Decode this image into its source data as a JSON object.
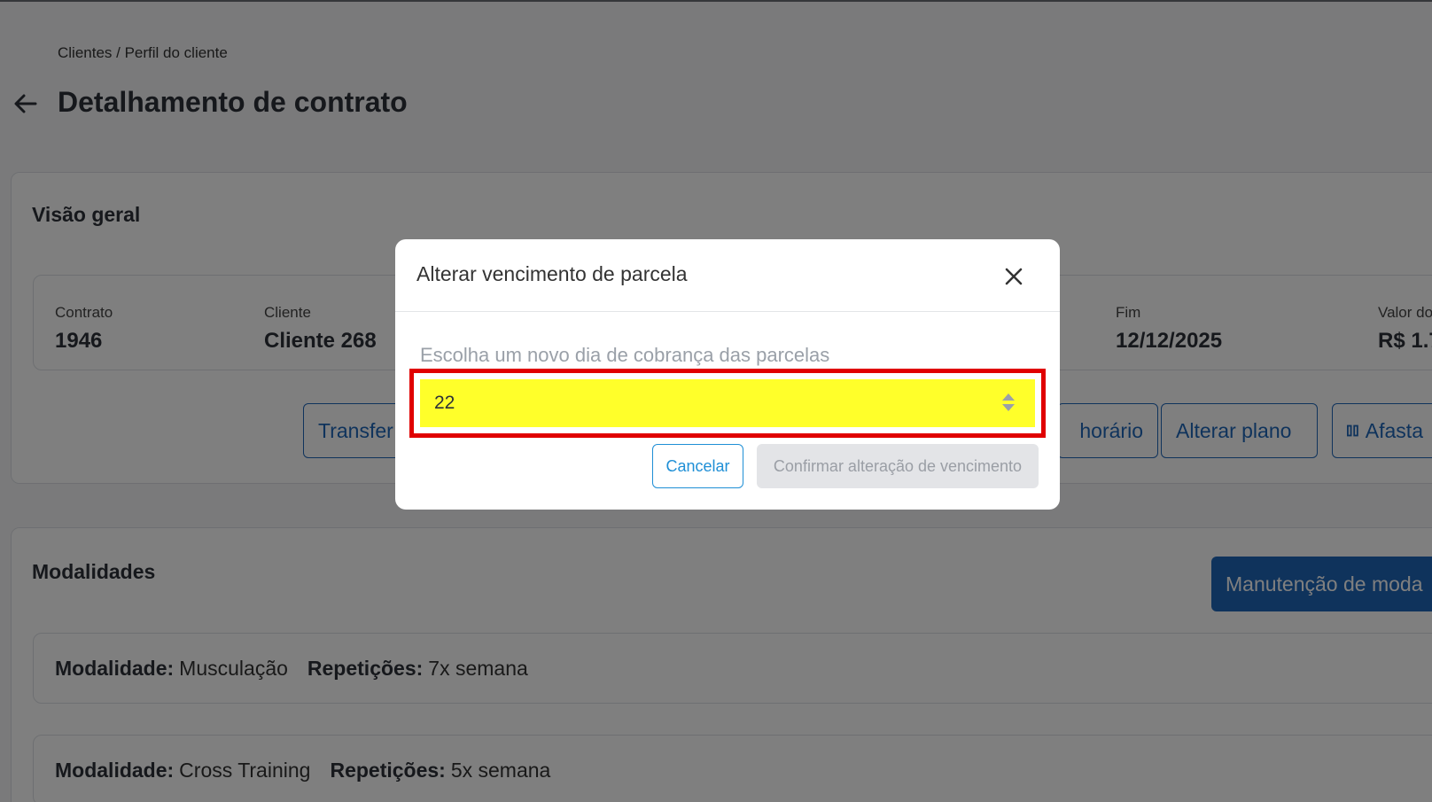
{
  "breadcrumb": "Clientes / Perfil do cliente",
  "page_title": "Detalhamento de contrato",
  "overview": {
    "title": "Visão geral",
    "fields": [
      {
        "label": "Contrato",
        "value": "1946"
      },
      {
        "label": "Cliente",
        "value": "Cliente 268"
      },
      {
        "label": "Fim",
        "value": "12/12/2025"
      },
      {
        "label": "Valor do",
        "value": "R$ 1.7"
      }
    ],
    "actions": [
      {
        "label": "Transfer"
      },
      {
        "label": "horário"
      },
      {
        "label": "Alterar plano"
      },
      {
        "label": "Afasta"
      }
    ]
  },
  "modalities": {
    "title": "Modalidades",
    "manage_button": "Manutenção de moda",
    "rows": [
      {
        "mod_label": "Modalidade:",
        "mod_value": "Musculação",
        "rep_label": "Repetições:",
        "rep_value": "7x semana"
      },
      {
        "mod_label": "Modalidade:",
        "mod_value": "Cross Training",
        "rep_label": "Repetições:",
        "rep_value": "5x semana"
      }
    ]
  },
  "modal": {
    "title": "Alterar vencimento de parcela",
    "field_label": "Escolha um novo dia de cobrança das parcelas",
    "selected_value": "22",
    "cancel_label": "Cancelar",
    "confirm_label": "Confirmar alteração de vencimento"
  },
  "colors": {
    "primary": "#1f66b8",
    "highlight_fill": "#ffff2a",
    "highlight_border": "#e00000"
  }
}
